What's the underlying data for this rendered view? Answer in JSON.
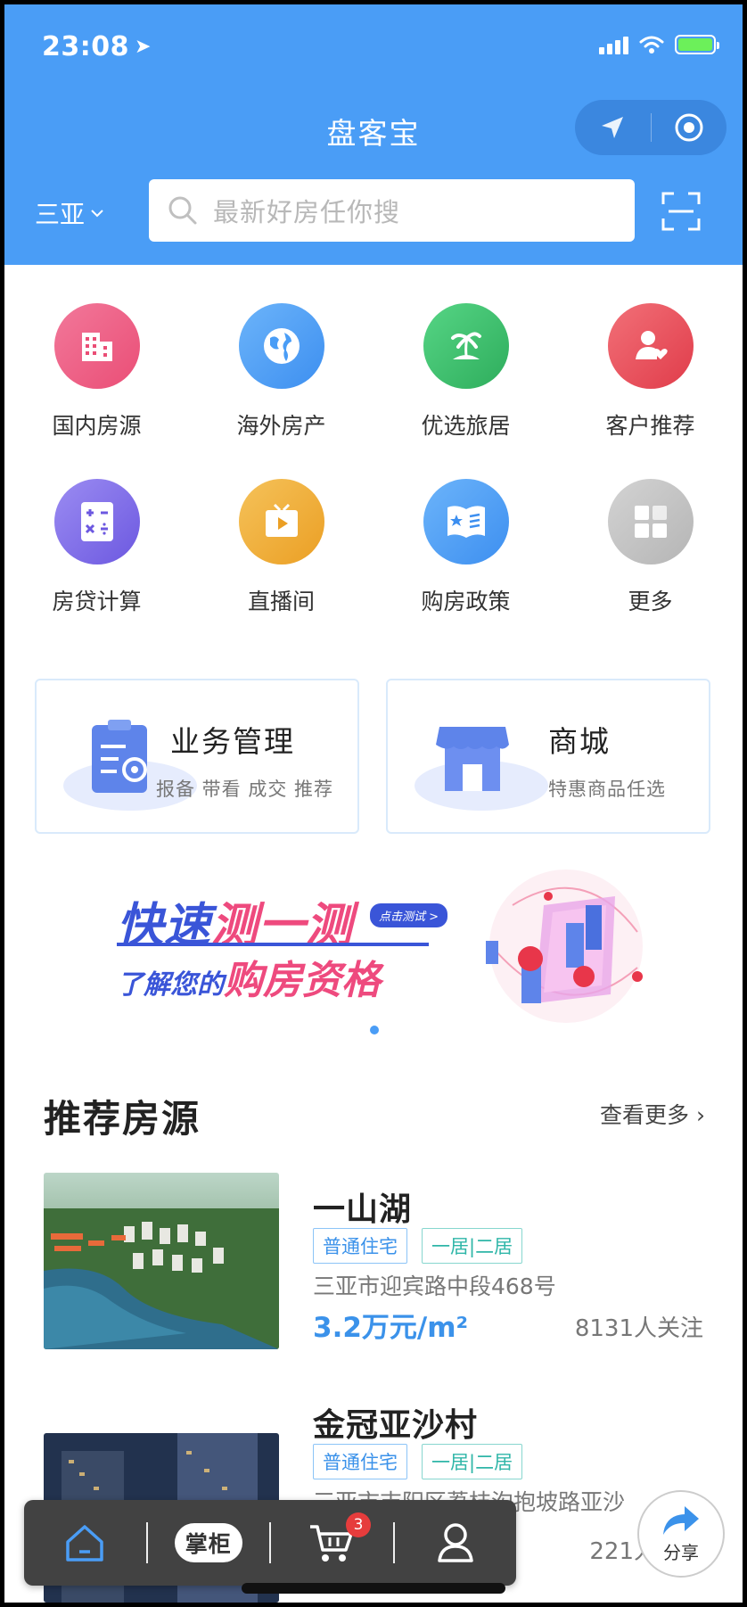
{
  "status": {
    "time": "23:08",
    "location_icon": "location-arrow-icon",
    "battery": "charging"
  },
  "header": {
    "title": "盘客宝",
    "city": "三亚",
    "search_placeholder": "最新好房任你搜"
  },
  "quick_menu": [
    {
      "label": "国内房源",
      "icon": "buildings-icon",
      "color": "#f0648a"
    },
    {
      "label": "海外房产",
      "icon": "globe-icon",
      "color": "#4a9df6"
    },
    {
      "label": "优选旅居",
      "icon": "palm-island-icon",
      "color": "#3fc06c"
    },
    {
      "label": "客户推荐",
      "icon": "user-heart-icon",
      "color": "#ea4e5a"
    },
    {
      "label": "房贷计算",
      "icon": "calculator-icon",
      "color": "#7d6be8"
    },
    {
      "label": "直播间",
      "icon": "tv-play-icon",
      "color": "#f0b13c"
    },
    {
      "label": "购房政策",
      "icon": "open-book-icon",
      "color": "#4a9df6"
    },
    {
      "label": "更多",
      "icon": "grid-more-icon",
      "color": "#c0c0c0"
    }
  ],
  "cards": {
    "business": {
      "title": "业务管理",
      "subtitle": "报备 带看 成交 推荐"
    },
    "mall": {
      "title": "商城",
      "subtitle": "特惠商品任选"
    }
  },
  "banner": {
    "line1_a": "快速",
    "line1_b": "测一测",
    "pill": "点击测试 >",
    "line2_a": "了解您的",
    "line2_b": "购房资格"
  },
  "section": {
    "title": "推荐房源",
    "more": "查看更多 ›"
  },
  "listings": [
    {
      "name": "一山湖",
      "tags": [
        "普通住宅",
        "一居|二居"
      ],
      "address": "三亚市迎宾路中段468号",
      "price": "3.2万元/m²",
      "follow": "8131人关注"
    },
    {
      "name": "金冠亚沙村",
      "tags": [
        "普通住宅",
        "一居|二居"
      ],
      "address": "三亚市吉阳区荔枝沟抱坡路亚沙",
      "price": "",
      "follow": "221人关注"
    }
  ],
  "tabbar": {
    "zhanggui": "掌柜",
    "cart_badge": "3",
    "share": "分享"
  }
}
